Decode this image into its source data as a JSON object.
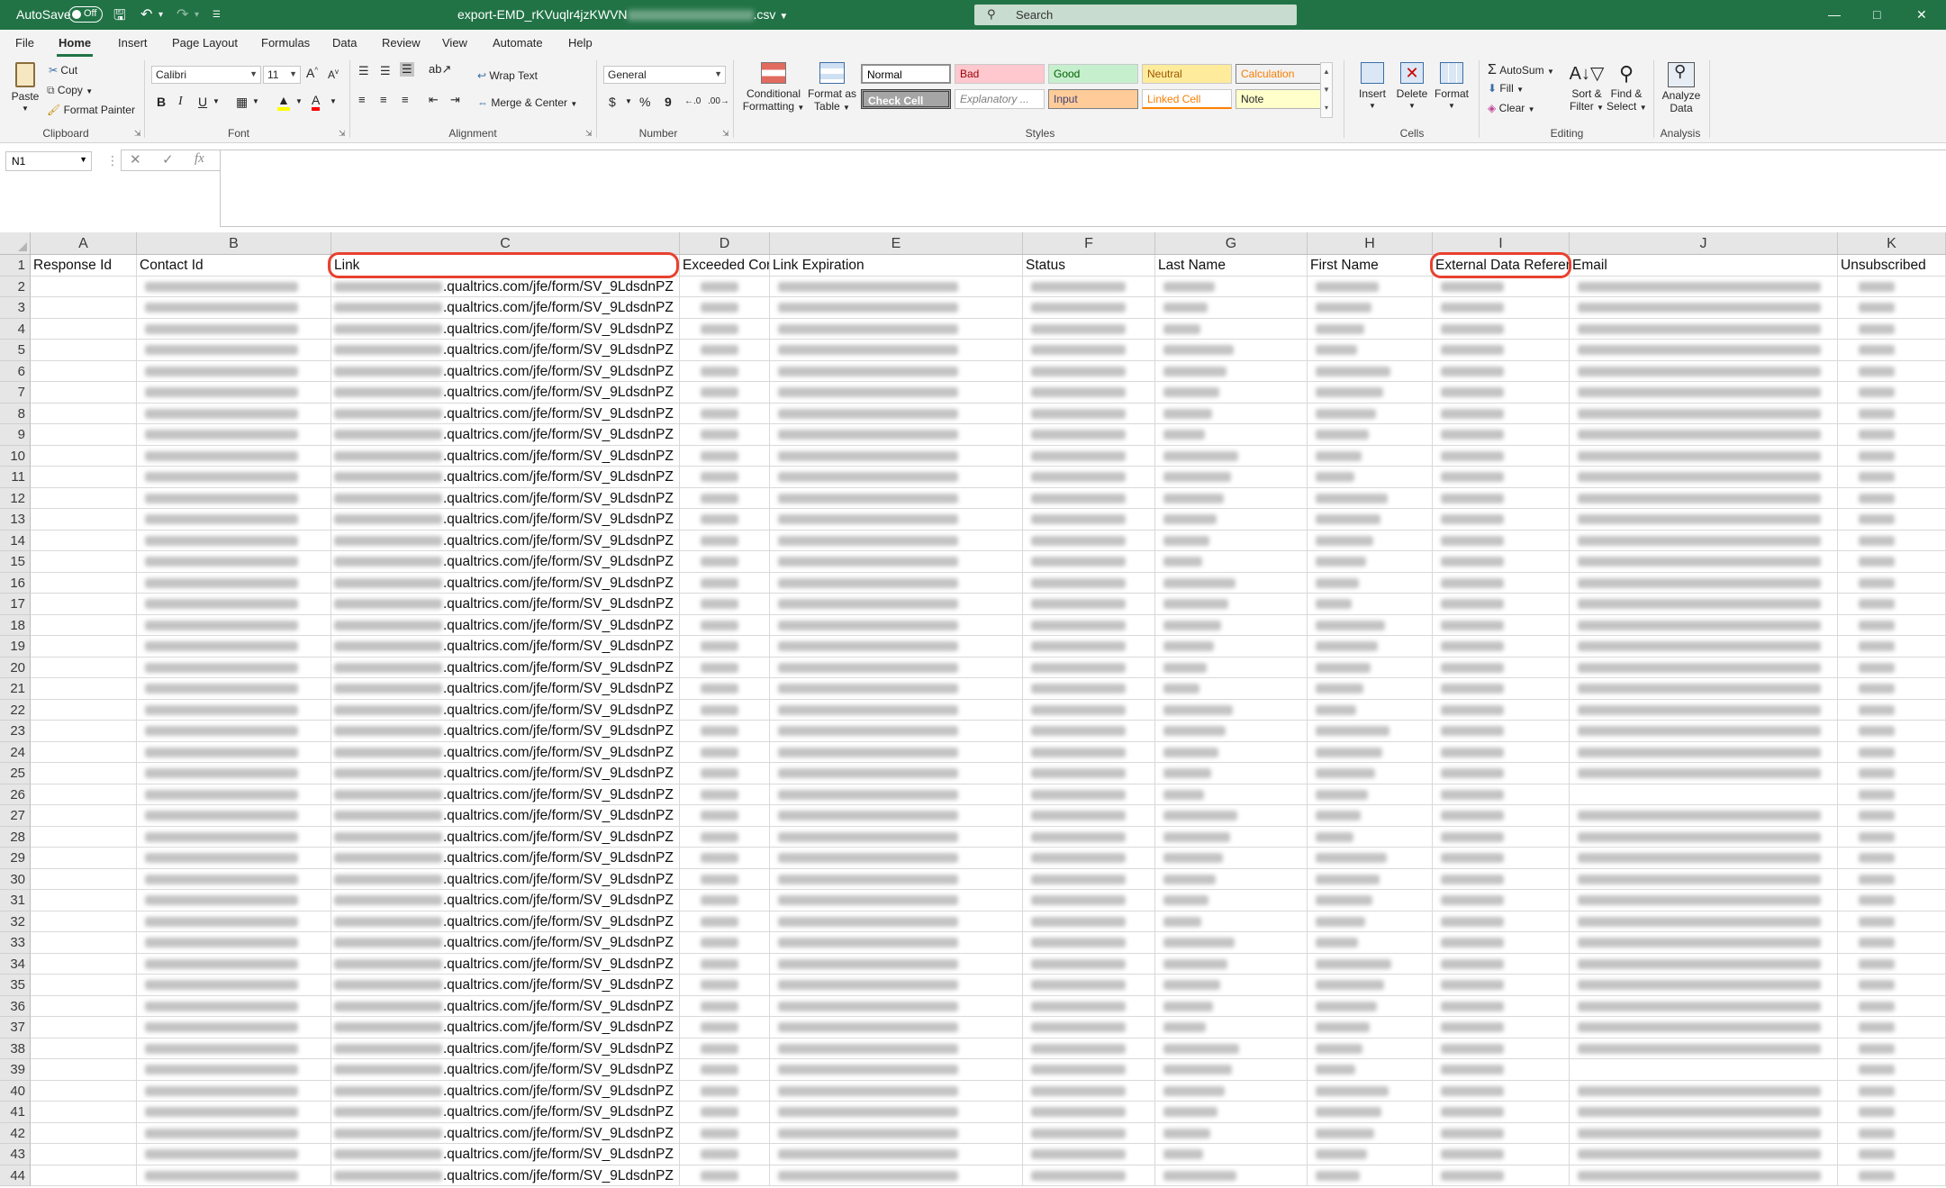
{
  "titlebar": {
    "autosave_label": "AutoSave",
    "autosave_state": "Off",
    "document_title": "export-EMD_rKVuqlr4jzKWVN",
    "document_ext": ".csv",
    "search_placeholder": "Search"
  },
  "menu_tabs": [
    "File",
    "Home",
    "Insert",
    "Page Layout",
    "Formulas",
    "Data",
    "Review",
    "View",
    "Automate",
    "Help"
  ],
  "active_tab": "Home",
  "ribbon": {
    "clipboard": {
      "paste": "Paste",
      "cut": "Cut",
      "copy": "Copy",
      "format_painter": "Format Painter",
      "group": "Clipboard"
    },
    "font": {
      "name": "Calibri",
      "size": "11",
      "group": "Font"
    },
    "alignment": {
      "wrap_text": "Wrap Text",
      "merge_center": "Merge & Center",
      "group": "Alignment"
    },
    "number": {
      "format": "General",
      "group": "Number"
    },
    "styles": {
      "conditional_formatting_1": "Conditional",
      "conditional_formatting_2": "Formatting",
      "format_as_table_1": "Format as",
      "format_as_table_2": "Table",
      "gallery": [
        "Normal",
        "Bad",
        "Good",
        "Neutral",
        "Calculation",
        "Check Cell",
        "Explanatory ...",
        "Input",
        "Linked Cell",
        "Note"
      ],
      "group": "Styles"
    },
    "cells": {
      "insert": "Insert",
      "delete": "Delete",
      "format": "Format",
      "group": "Cells"
    },
    "editing": {
      "autosum": "AutoSum",
      "fill": "Fill",
      "clear": "Clear",
      "sort_filter_1": "Sort &",
      "sort_filter_2": "Filter",
      "find_select_1": "Find &",
      "find_select_2": "Select",
      "group": "Editing"
    },
    "analysis": {
      "analyze_1": "Analyze",
      "analyze_2": "Data",
      "group": "Analysis"
    },
    "colors": {
      "bad_bg": "#ffc7ce",
      "bad_fg": "#9c0006",
      "good_bg": "#c6efce",
      "good_fg": "#006100",
      "neutral_bg": "#ffeb9c",
      "neutral_fg": "#9c5700",
      "calc_fg": "#fa7d00",
      "check_bg": "#a5a5a5",
      "input_bg": "#ffcc99",
      "linked_fg": "#fa7d00",
      "note_bg": "#ffffcc"
    }
  },
  "formula_bar": {
    "name_box": "N1",
    "formula": ""
  },
  "sheet": {
    "columns": [
      "A",
      "B",
      "C",
      "D",
      "E",
      "F",
      "G",
      "H",
      "I",
      "J",
      "K"
    ],
    "headers": [
      "Response Id",
      "Contact Id",
      "Link",
      "Exceeded Contact Frequency",
      "Link Expiration",
      "Status",
      "Last Name",
      "First Name",
      "External Data Reference",
      "Email",
      "Unsubscribed"
    ],
    "first_data_row": 2,
    "last_row": 44,
    "link_visible_text": ".qualtrics.com/jfe/form/SV_9LdsdnPZ"
  },
  "annotations": [
    "Link",
    "External Data Refere"
  ],
  "accent_color": "#217346",
  "annotation_color": "#e8412f"
}
